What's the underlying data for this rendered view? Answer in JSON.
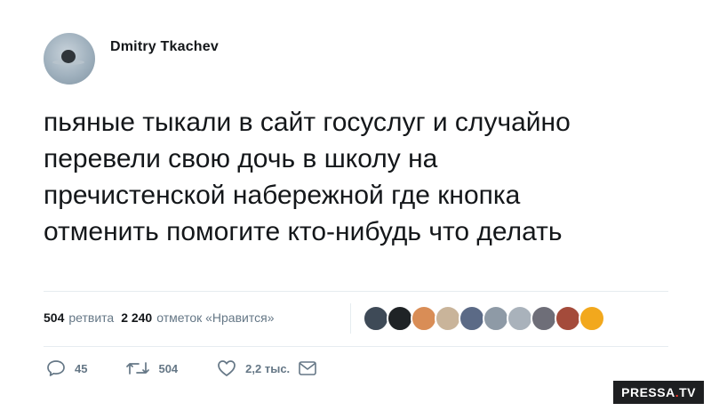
{
  "author": {
    "name": "Dmitry Tkachev"
  },
  "tweet": {
    "lines": [
      "пьяные тыкали в сайт госуслуг и случайно",
      "перевели свою дочь в школу на",
      "пречистенской набережной где кнопка",
      "отменить помогите кто-нибудь что делать"
    ]
  },
  "stats": {
    "retweets_count": "504",
    "retweets_label": "ретвита",
    "likes_count": "2 240",
    "likes_label": "отметок «Нравится»"
  },
  "likers": [
    {
      "name": "liker-1",
      "color": "#3e4a57"
    },
    {
      "name": "liker-2",
      "color": "#1f2326"
    },
    {
      "name": "liker-3",
      "color": "#d98d56"
    },
    {
      "name": "liker-4",
      "color": "#c9b49a"
    },
    {
      "name": "liker-5",
      "color": "#5b6a86"
    },
    {
      "name": "liker-6",
      "color": "#8e9aa6"
    },
    {
      "name": "liker-7",
      "color": "#a9b2bb"
    },
    {
      "name": "liker-8",
      "color": "#6e6e78"
    },
    {
      "name": "liker-9",
      "color": "#a44b3b"
    },
    {
      "name": "liker-10",
      "color": "#f2a81d"
    }
  ],
  "actions": {
    "replies": "45",
    "retweets": "504",
    "likes": "2,2 тыс."
  },
  "watermark": {
    "part1": "PRESSA",
    "dot": ".",
    "part2": "TV"
  }
}
